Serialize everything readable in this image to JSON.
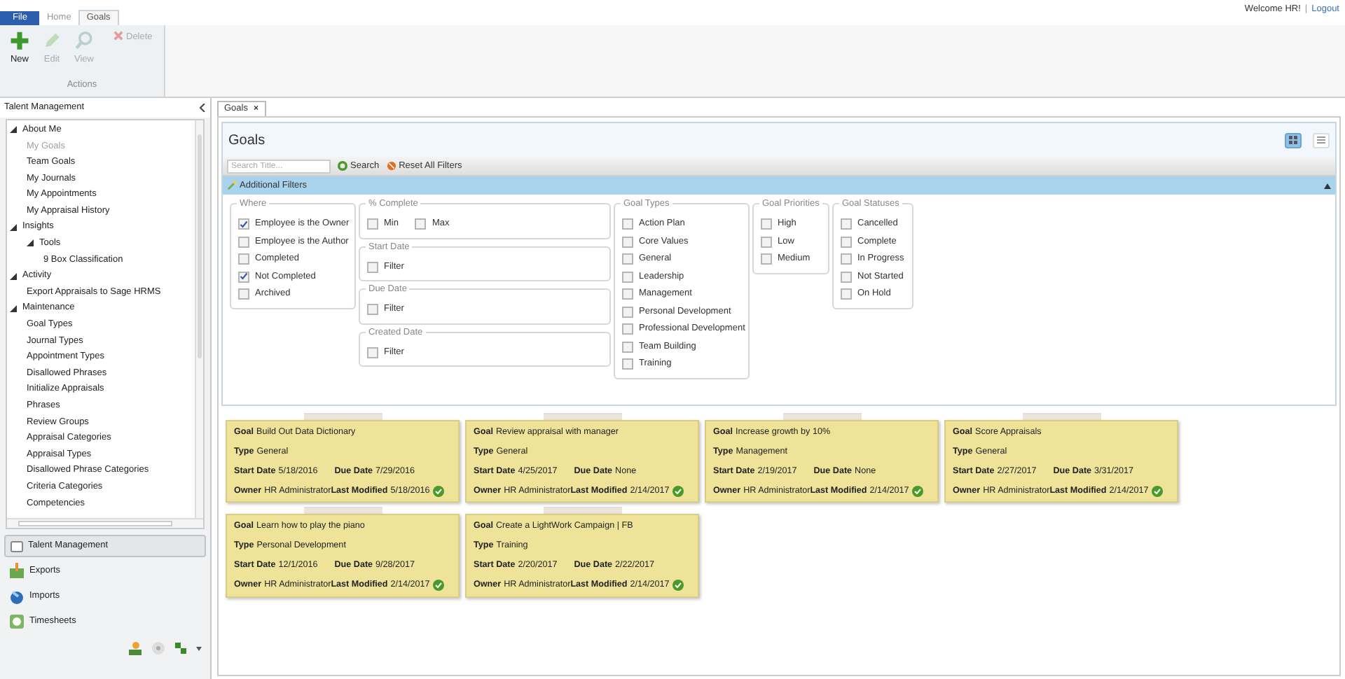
{
  "header": {
    "welcome": "Welcome HR!",
    "separator": "|",
    "logout": "Logout"
  },
  "menu_tabs": [
    {
      "label": "File",
      "kind": "file",
      "selected": false
    },
    {
      "label": "Home",
      "kind": "tab",
      "selected": false
    },
    {
      "label": "Goals",
      "kind": "tab",
      "selected": true
    }
  ],
  "ribbon": {
    "group_label": "Actions",
    "buttons": [
      {
        "label": "New",
        "kind": "new",
        "disabled": false
      },
      {
        "label": "Edit",
        "kind": "edit",
        "disabled": true
      },
      {
        "label": "View",
        "kind": "view",
        "disabled": true
      },
      {
        "label": "Delete",
        "kind": "delete",
        "disabled": true
      }
    ]
  },
  "sidebar": {
    "title": "Talent Management",
    "tree": [
      {
        "label": "About Me",
        "expanded": true,
        "selected": false,
        "children": [
          {
            "label": "My Goals",
            "selected": true
          },
          {
            "label": "Team Goals",
            "selected": false
          },
          {
            "label": "My Journals",
            "selected": false
          },
          {
            "label": "My Appointments",
            "selected": false
          },
          {
            "label": "My Appraisal History",
            "selected": false
          }
        ]
      },
      {
        "label": "Insights",
        "expanded": true,
        "selected": false,
        "children": [
          {
            "label": "Tools",
            "expanded": true,
            "selected": false,
            "children": [
              {
                "label": "9 Box Classification",
                "selected": false
              }
            ]
          }
        ]
      },
      {
        "label": "Activity",
        "expanded": true,
        "selected": false,
        "children": [
          {
            "label": "Export Appraisals to Sage HRMS",
            "selected": false
          }
        ]
      },
      {
        "label": "Maintenance",
        "expanded": true,
        "selected": false,
        "children": [
          {
            "label": "Goal Types",
            "selected": false
          },
          {
            "label": "Journal Types",
            "selected": false
          },
          {
            "label": "Appointment Types",
            "selected": false
          },
          {
            "label": "Disallowed Phrases",
            "selected": false
          },
          {
            "label": "Initialize Appraisals",
            "selected": false
          },
          {
            "label": "Phrases",
            "selected": false
          },
          {
            "label": "Review Groups",
            "selected": false
          },
          {
            "label": "Appraisal Categories",
            "selected": false
          },
          {
            "label": "Appraisal Types",
            "selected": false
          },
          {
            "label": "Disallowed Phrase Categories",
            "selected": false
          },
          {
            "label": "Criteria Categories",
            "selected": false
          },
          {
            "label": "Competencies",
            "selected": false
          }
        ]
      }
    ],
    "sections": [
      {
        "label": "Talent Management",
        "kind": "talent",
        "selected": true
      },
      {
        "label": "Exports",
        "kind": "exports",
        "selected": false
      },
      {
        "label": "Imports",
        "kind": "imports",
        "selected": false
      },
      {
        "label": "Timesheets",
        "kind": "timesheets",
        "selected": false
      }
    ]
  },
  "doc_tab": {
    "label": "Goals",
    "close": "×"
  },
  "panel": {
    "title": "Goals",
    "view_toggles": [
      {
        "kind": "cards",
        "selected": true
      },
      {
        "kind": "list",
        "selected": false
      }
    ],
    "search": {
      "placeholder": "Search Title..."
    },
    "search_button": "Search",
    "reset_button": "Reset All Filters",
    "filters_bar": {
      "label": "Additional Filters",
      "expanded": true
    },
    "filter_columns": [
      [
        {
          "title": "Where",
          "kind": "list",
          "items": [
            {
              "label": "Employee is the Owner",
              "checked": true
            },
            {
              "label": "Employee is the Author",
              "checked": false
            },
            {
              "label": "Completed",
              "checked": false
            },
            {
              "label": "Not Completed",
              "checked": true
            },
            {
              "label": "Archived",
              "checked": false
            }
          ]
        }
      ],
      [
        {
          "title": "% Complete",
          "kind": "range",
          "items": [
            {
              "label": "Min",
              "checked": false
            },
            {
              "label": "Max",
              "checked": false
            }
          ]
        },
        {
          "title": "Start Date",
          "kind": "list",
          "items": [
            {
              "label": "Filter",
              "checked": false
            }
          ]
        },
        {
          "title": "Due Date",
          "kind": "list",
          "items": [
            {
              "label": "Filter",
              "checked": false
            }
          ]
        },
        {
          "title": "Created Date",
          "kind": "list",
          "items": [
            {
              "label": "Filter",
              "checked": false
            }
          ]
        }
      ],
      [
        {
          "title": "Goal Types",
          "kind": "list",
          "items": [
            {
              "label": "Action Plan",
              "checked": false
            },
            {
              "label": "Core Values",
              "checked": false
            },
            {
              "label": "General",
              "checked": false
            },
            {
              "label": "Leadership",
              "checked": false
            },
            {
              "label": "Management",
              "checked": false
            },
            {
              "label": "Personal Development",
              "checked": false
            },
            {
              "label": "Professional Development",
              "checked": false
            },
            {
              "label": "Team Building",
              "checked": false
            },
            {
              "label": "Training",
              "checked": false
            }
          ]
        }
      ],
      [
        {
          "title": "Goal Priorities",
          "kind": "list",
          "items": [
            {
              "label": "High",
              "checked": false
            },
            {
              "label": "Low",
              "checked": false
            },
            {
              "label": "Medium",
              "checked": false
            }
          ]
        }
      ],
      [
        {
          "title": "Goal Statuses",
          "kind": "list",
          "items": [
            {
              "label": "Cancelled",
              "checked": false
            },
            {
              "label": "Complete",
              "checked": false
            },
            {
              "label": "In Progress",
              "checked": false
            },
            {
              "label": "Not Started",
              "checked": false
            },
            {
              "label": "On Hold",
              "checked": false
            }
          ]
        }
      ]
    ]
  },
  "cards": [
    {
      "rows": [
        [
          {
            "label": "Goal",
            "value": "Build Out Data Dictionary"
          }
        ],
        [
          {
            "label": "Type",
            "value": "General"
          }
        ],
        [
          {
            "label": "Start Date",
            "value": "5/18/2016"
          },
          {
            "label": "Due Date",
            "value": "7/29/2016"
          }
        ],
        [
          {
            "label": "Owner",
            "value": "HR Administrator"
          },
          {
            "label": "Last Modified",
            "value": "5/18/2016"
          }
        ]
      ]
    },
    {
      "rows": [
        [
          {
            "label": "Goal",
            "value": "Review appraisal with manager"
          }
        ],
        [
          {
            "label": "Type",
            "value": "General"
          }
        ],
        [
          {
            "label": "Start Date",
            "value": "4/25/2017"
          },
          {
            "label": "Due Date",
            "value": "None"
          }
        ],
        [
          {
            "label": "Owner",
            "value": "HR Administrator"
          },
          {
            "label": "Last Modified",
            "value": "2/14/2017"
          }
        ]
      ]
    },
    {
      "rows": [
        [
          {
            "label": "Goal",
            "value": "Increase growth by 10%"
          }
        ],
        [
          {
            "label": "Type",
            "value": "Management"
          }
        ],
        [
          {
            "label": "Start Date",
            "value": "2/19/2017"
          },
          {
            "label": "Due Date",
            "value": "None"
          }
        ],
        [
          {
            "label": "Owner",
            "value": "HR Administrator"
          },
          {
            "label": "Last Modified",
            "value": "2/14/2017"
          }
        ]
      ]
    },
    {
      "rows": [
        [
          {
            "label": "Goal",
            "value": "Score Appraisals"
          }
        ],
        [
          {
            "label": "Type",
            "value": "General"
          }
        ],
        [
          {
            "label": "Start Date",
            "value": "2/27/2017"
          },
          {
            "label": "Due Date",
            "value": "3/31/2017"
          }
        ],
        [
          {
            "label": "Owner",
            "value": "HR Administrator"
          },
          {
            "label": "Last Modified",
            "value": "2/14/2017"
          }
        ]
      ]
    },
    {
      "rows": [
        [
          {
            "label": "Goal",
            "value": "Learn how to play the piano"
          }
        ],
        [
          {
            "label": "Type",
            "value": "Personal Development"
          }
        ],
        [
          {
            "label": "Start Date",
            "value": "12/1/2016"
          },
          {
            "label": "Due Date",
            "value": "9/28/2017"
          }
        ],
        [
          {
            "label": "Owner",
            "value": "HR Administrator"
          },
          {
            "label": "Last Modified",
            "value": "2/14/2017"
          }
        ]
      ]
    },
    {
      "rows": [
        [
          {
            "label": "Goal",
            "value": "Create a LightWork Campaign | FB"
          }
        ],
        [
          {
            "label": "Type",
            "value": "Training"
          }
        ],
        [
          {
            "label": "Start Date",
            "value": "2/20/2017"
          },
          {
            "label": "Due Date",
            "value": "2/22/2017"
          }
        ],
        [
          {
            "label": "Owner",
            "value": "HR Administrator"
          },
          {
            "label": "Last Modified",
            "value": "2/14/2017"
          }
        ]
      ]
    }
  ]
}
